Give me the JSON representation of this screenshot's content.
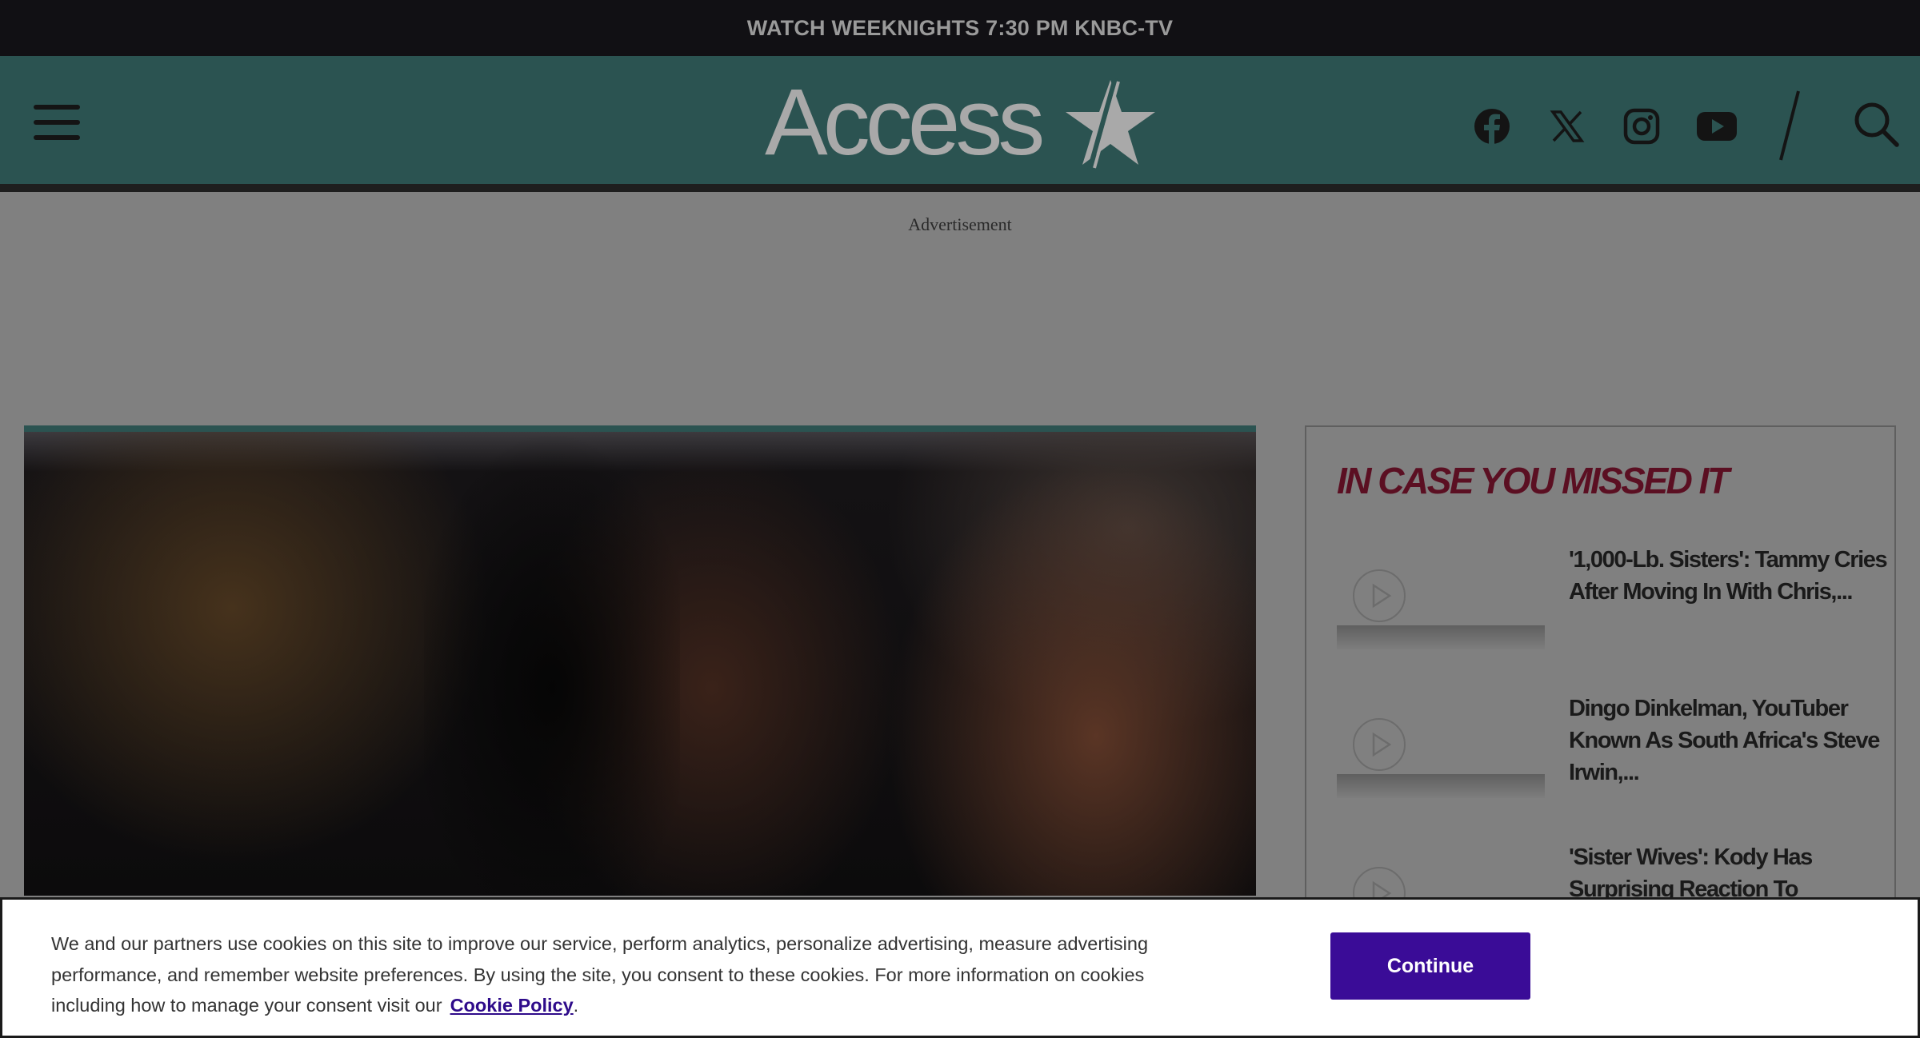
{
  "topbar": {
    "text": "WATCH WEEKNIGHTS 7:30 PM KNBC-TV"
  },
  "header": {
    "logo_text": "Access",
    "social": [
      {
        "name": "facebook",
        "icon": "facebook-icon"
      },
      {
        "name": "x",
        "icon": "x-icon"
      },
      {
        "name": "instagram",
        "icon": "instagram-icon"
      },
      {
        "name": "youtube",
        "icon": "youtube-icon"
      }
    ],
    "search_icon": "search-icon",
    "menu_icon": "hamburger-menu-icon"
  },
  "ad": {
    "label": "Advertisement"
  },
  "sidebar": {
    "title": "IN CASE YOU MISSED IT",
    "items": [
      {
        "title": "'1,000-Lb. Sisters': Tammy Cries After Moving In With Chris,..."
      },
      {
        "title": "Dingo Dinkelman, YouTuber Known As South Africa's Steve Irwin,..."
      },
      {
        "title": "'Sister Wives': Kody Has Surprising Reaction To Christine"
      }
    ]
  },
  "cookie": {
    "text": "We and our partners use cookies on this site to improve our service, perform analytics, personalize advertising, measure advertising performance, and remember website preferences. By using the site, you consent to these cookies. For more information on cookies including how to manage your consent visit our",
    "link": "Cookie Policy",
    "trailing": ".",
    "button": "Continue"
  },
  "colors": {
    "header_bg": "#2b5351",
    "topbar_bg": "#111014",
    "sidebar_title": "#5b0f22",
    "button_bg": "#3a0c97",
    "link": "#2e0b8a"
  }
}
